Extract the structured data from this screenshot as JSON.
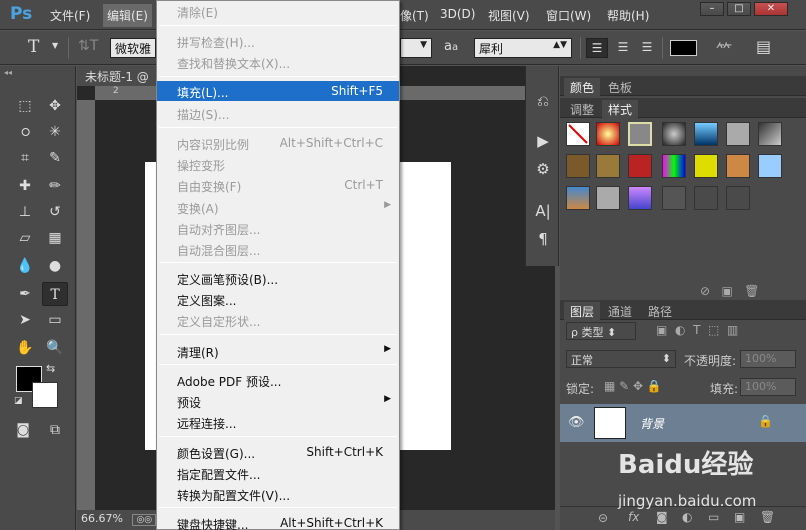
{
  "app": {
    "logo": "Ps"
  },
  "menubar": {
    "file": "文件(F)",
    "edit": "编辑(E)",
    "image_partial": "像(T)",
    "3d": "3D(D)",
    "view": "视图(V)",
    "window": "窗口(W)",
    "help": "帮助(H)"
  },
  "options": {
    "font_family": "微软雅",
    "aa_label": "a",
    "aa_mode": "犀利"
  },
  "document": {
    "tab_title": "未标题-1 @",
    "ruler_mark": "2",
    "zoom": "66.67%"
  },
  "edit_menu": {
    "items": [
      {
        "label": "清除(E)",
        "shortcut": "",
        "disabled": true
      },
      {
        "label": "拼写检查(H)...",
        "shortcut": "",
        "disabled": true
      },
      {
        "label": "查找和替换文本(X)...",
        "shortcut": "",
        "disabled": true
      },
      {
        "label": "填充(L)...",
        "shortcut": "Shift+F5",
        "disabled": false,
        "highlight": true
      },
      {
        "label": "描边(S)...",
        "shortcut": "",
        "disabled": true
      },
      {
        "label": "内容识别比例",
        "shortcut": "Alt+Shift+Ctrl+C",
        "disabled": true
      },
      {
        "label": "操控变形",
        "shortcut": "",
        "disabled": true
      },
      {
        "label": "自由变换(F)",
        "shortcut": "Ctrl+T",
        "disabled": true
      },
      {
        "label": "变换(A)",
        "shortcut": "",
        "disabled": true,
        "submenu": true
      },
      {
        "label": "自动对齐图层...",
        "shortcut": "",
        "disabled": true
      },
      {
        "label": "自动混合图层...",
        "shortcut": "",
        "disabled": true
      },
      {
        "label": "定义画笔预设(B)...",
        "shortcut": "",
        "disabled": false
      },
      {
        "label": "定义图案...",
        "shortcut": "",
        "disabled": false
      },
      {
        "label": "定义自定形状...",
        "shortcut": "",
        "disabled": true
      },
      {
        "label": "清理(R)",
        "shortcut": "",
        "disabled": false,
        "submenu": true
      },
      {
        "label": "Adobe PDF 预设...",
        "shortcut": "",
        "disabled": false
      },
      {
        "label": "预设",
        "shortcut": "",
        "disabled": false,
        "submenu": true
      },
      {
        "label": "远程连接...",
        "shortcut": "",
        "disabled": false
      },
      {
        "label": "颜色设置(G)...",
        "shortcut": "Shift+Ctrl+K",
        "disabled": false
      },
      {
        "label": "指定配置文件...",
        "shortcut": "",
        "disabled": false
      },
      {
        "label": "转换为配置文件(V)...",
        "shortcut": "",
        "disabled": false
      },
      {
        "label": "键盘快捷键...",
        "shortcut": "Alt+Shift+Ctrl+K",
        "disabled": false
      }
    ]
  },
  "panels": {
    "color_tab": "颜色",
    "swatches_tab": "色板",
    "adjust_tab": "调整",
    "styles_tab": "样式",
    "layers_tab": "图层",
    "channels_tab": "通道",
    "paths_tab": "路径",
    "kind_filter": "ρ 类型",
    "blend_mode": "正常",
    "opacity_label": "不透明度:",
    "opacity_value": "100%",
    "lock_label": "锁定:",
    "fill_label": "填充:",
    "fill_value": "100%",
    "layer_name": "背景"
  },
  "watermark": {
    "brand": "Baidu经验",
    "url": "jingyan.baidu.com"
  },
  "colors": {
    "highlight": "#1e6fc9",
    "layer_selected": "#6c7f93"
  }
}
